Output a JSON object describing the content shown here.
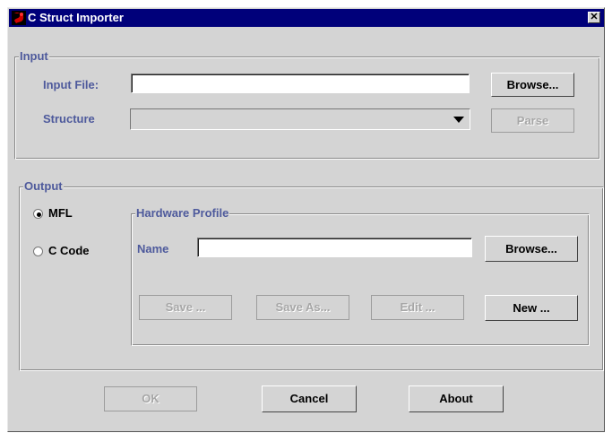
{
  "window": {
    "title": "C Struct Importer",
    "close_label": "✕"
  },
  "input_group": {
    "legend": "Input",
    "input_file_label": "Input File:",
    "input_file_value": "",
    "browse_label": "Browse...",
    "structure_label": "Structure",
    "structure_value": "",
    "parse_label": "Parse"
  },
  "output_group": {
    "legend": "Output",
    "options": [
      {
        "label": "MFL",
        "selected": true
      },
      {
        "label": "C Code",
        "selected": false
      }
    ],
    "hardware_profile": {
      "legend": "Hardware Profile",
      "name_label": "Name",
      "name_value": "",
      "browse_label": "Browse...",
      "save_label": "Save ...",
      "save_as_label": "Save As...",
      "edit_label": "Edit ...",
      "new_label": "New ..."
    }
  },
  "footer": {
    "ok_label": "OK",
    "cancel_label": "Cancel",
    "about_label": "About"
  },
  "colors": {
    "title_bar": "#00007a",
    "label_text": "#4e5a9c",
    "panel_bg": "#d4d4d4"
  }
}
